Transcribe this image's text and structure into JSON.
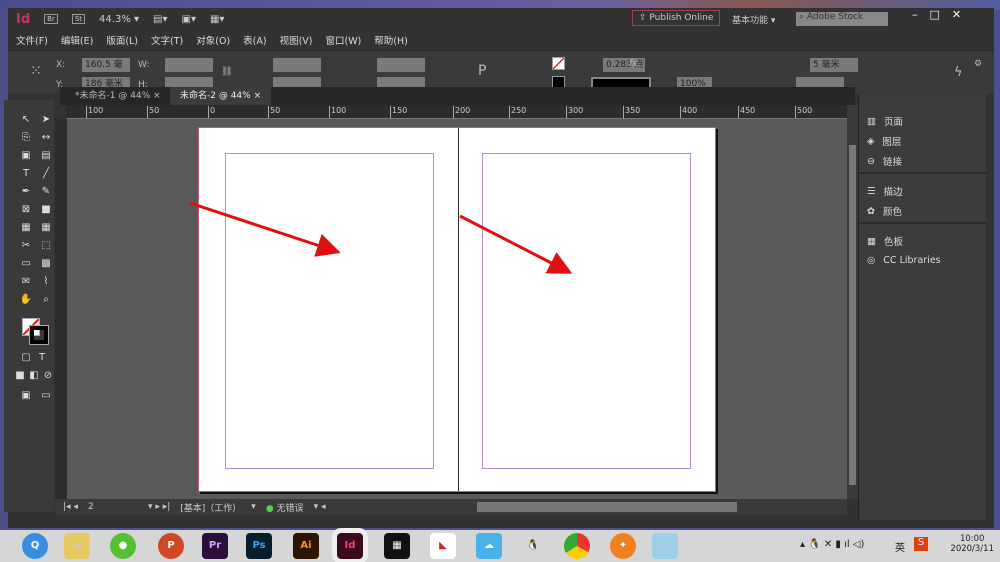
{
  "app": {
    "logo": "Id",
    "bridge": "Br",
    "stock": "St",
    "zoom": "44.3%",
    "publish": "Publish Online",
    "workspace": "基本功能",
    "search_placeholder": "Adobe Stock"
  },
  "menu": [
    "文件(F)",
    "编辑(E)",
    "版面(L)",
    "文字(T)",
    "对象(O)",
    "表(A)",
    "视图(V)",
    "窗口(W)",
    "帮助(H)"
  ],
  "control": {
    "x_label": "X:",
    "x": "160.5 毫米",
    "y_label": "Y:",
    "y": "186 毫米",
    "w_label": "W:",
    "h_label": "H:",
    "stroke_weight": "0.283 点",
    "opacity": "100%",
    "corner": "5 毫米"
  },
  "tabs": [
    {
      "label": "*未命名-1 @ 44%",
      "close": "×"
    },
    {
      "label": "未命名-2 @ 44%",
      "close": "×"
    }
  ],
  "ruler": [
    "100",
    "50",
    "0",
    "50",
    "100",
    "150",
    "200",
    "250",
    "300",
    "350",
    "400",
    "450",
    "500"
  ],
  "panels": [
    [
      "页面",
      "图层",
      "链接"
    ],
    [
      "描边",
      "颜色"
    ],
    [
      "色板",
      "CC Libraries"
    ]
  ],
  "status": {
    "page": "2",
    "master": "[基本]（工作）",
    "preflight": "无错误"
  },
  "taskbar": {
    "apps": [
      "Pr",
      "Ps",
      "Ai",
      "Id"
    ],
    "lang": "英",
    "time": "10:00",
    "date": "2020/3/11"
  },
  "colors": {
    "arrow": "#e01010",
    "accent": "#d0306a"
  }
}
